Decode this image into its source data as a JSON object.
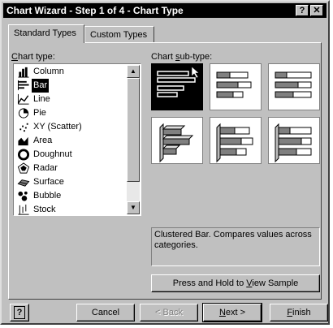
{
  "window": {
    "title": "Chart Wizard - Step 1 of 4 - Chart Type",
    "help_btn": "?",
    "close_btn": "✕"
  },
  "tabs": [
    {
      "label": "Standard Types",
      "active": true
    },
    {
      "label": "Custom Types",
      "active": false
    }
  ],
  "chart_type": {
    "label_prefix": "",
    "label_key": "C",
    "label_rest": "hart type:",
    "items": [
      {
        "label": "Column",
        "icon": "column-chart-icon",
        "selected": false
      },
      {
        "label": "Bar",
        "icon": "bar-chart-icon",
        "selected": true
      },
      {
        "label": "Line",
        "icon": "line-chart-icon",
        "selected": false
      },
      {
        "label": "Pie",
        "icon": "pie-chart-icon",
        "selected": false
      },
      {
        "label": "XY (Scatter)",
        "icon": "scatter-chart-icon",
        "selected": false
      },
      {
        "label": "Area",
        "icon": "area-chart-icon",
        "selected": false
      },
      {
        "label": "Doughnut",
        "icon": "doughnut-chart-icon",
        "selected": false
      },
      {
        "label": "Radar",
        "icon": "radar-chart-icon",
        "selected": false
      },
      {
        "label": "Surface",
        "icon": "surface-chart-icon",
        "selected": false
      },
      {
        "label": "Bubble",
        "icon": "bubble-chart-icon",
        "selected": false
      },
      {
        "label": "Stock",
        "icon": "stock-chart-icon",
        "selected": false
      }
    ]
  },
  "subtype": {
    "label_prefix": "Chart ",
    "label_key": "s",
    "label_rest": "ub-type:",
    "description": "Clustered Bar. Compares values across categories.",
    "selected_index": 0
  },
  "buttons": {
    "view_sample_pre": "Press and Hold to ",
    "view_sample_key": "V",
    "view_sample_post": "iew Sample",
    "help": "?",
    "cancel": "Cancel",
    "back": "< Back",
    "next_key": "N",
    "next_rest": "ext >",
    "finish_key": "F",
    "finish_rest": "inish"
  }
}
